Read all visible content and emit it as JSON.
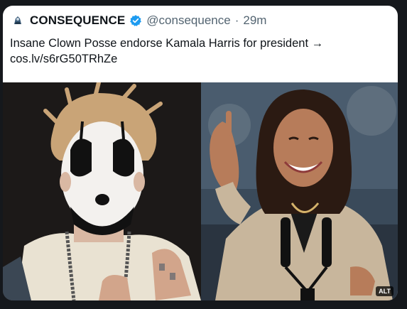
{
  "tweet": {
    "display_name": "CONSEQUENCE",
    "handle": "@consequence",
    "separator": "·",
    "time": "29m",
    "text_line1": "Insane Clown Posse endorse Kamala Harris for president →",
    "text_line2": "cos.lv/s6rG50TRhZe"
  },
  "media": {
    "alt_label": "ALT",
    "left_image": "photo-man-in-clown-face-paint",
    "right_image": "photo-woman-smiling-pointing-at-podium"
  },
  "colors": {
    "background": "#15181c",
    "card": "#ffffff",
    "text": "#0f1419",
    "secondary_text": "#536471",
    "verified_blue": "#1d9bf0"
  }
}
